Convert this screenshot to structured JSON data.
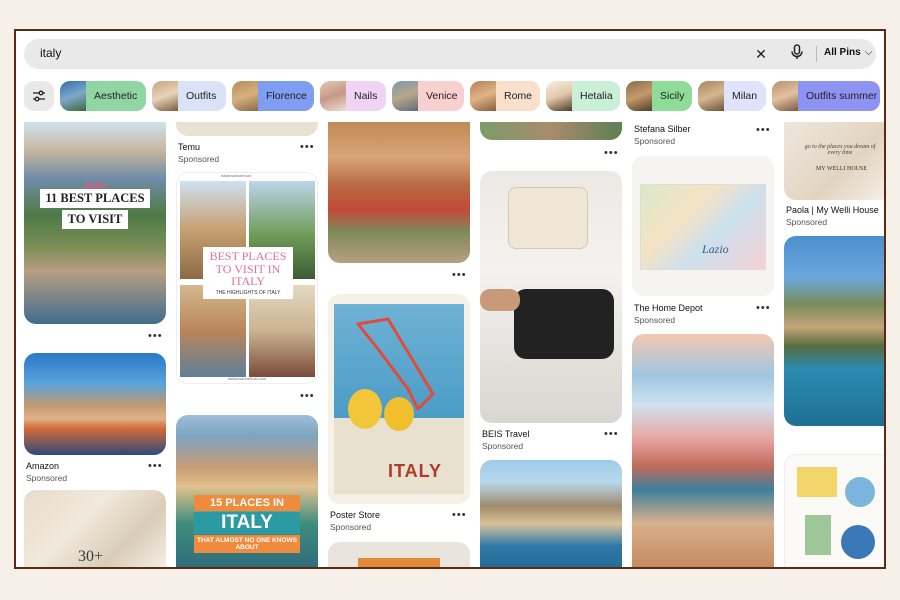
{
  "search": {
    "query": "italy",
    "scope_label": "All Pins"
  },
  "icons": {
    "clear": "close-icon",
    "voice": "microphone-icon",
    "filter": "sliders-icon",
    "chevron": "chevron-down-icon"
  },
  "chips": [
    {
      "label": "Aesthetic",
      "color": "#8fd6a2"
    },
    {
      "label": "Outfits",
      "color": "#d9e3f5"
    },
    {
      "label": "Florence",
      "color": "#7f9df2"
    },
    {
      "label": "Nails",
      "color": "#f0d4f4"
    },
    {
      "label": "Venice",
      "color": "#f8d0d0"
    },
    {
      "label": "Rome",
      "color": "#f8e0cc"
    },
    {
      "label": "Hetalia",
      "color": "#c9efd8"
    },
    {
      "label": "Sicily",
      "color": "#8fdc99"
    },
    {
      "label": "Milan",
      "color": "#dfe3fb"
    },
    {
      "label": "Outfits summer",
      "color": "#8d93f3"
    }
  ],
  "pins": {
    "best_places": {
      "line1": "Italy",
      "line2": "11 BEST PLACES",
      "line3": "TO VISIT"
    },
    "temu": {
      "source": "Temu",
      "sponsored": "Sponsored"
    },
    "wanderlust": {
      "site": "italianwanderlust",
      "title": "BEST PLACES TO VISIT IN ITALY",
      "subtitle": "THE HIGHLIGHTS OF ITALY",
      "footer": "italianwanderlust.com"
    },
    "amazon": {
      "source": "Amazon",
      "sponsored": "Sponsored"
    },
    "fifteen": {
      "line1": "15 PLACES IN",
      "line2": "ITALY",
      "line3": "THAT ALMOST NO ONE KNOWS ABOUT"
    },
    "poster": {
      "title": "ITALY",
      "source": "Poster Store",
      "sponsored": "Sponsored"
    },
    "beis": {
      "source": "BEIS Travel",
      "sponsored": "Sponsored"
    },
    "stefana": {
      "source": "Stefana Silber",
      "sponsored": "Sponsored"
    },
    "homedepot": {
      "map_text": "Lazio",
      "source": "The Home Depot",
      "sponsored": "Sponsored"
    },
    "welli": {
      "quote": "go to the places you dream of every time",
      "brand": "MY WELLI HOUSE",
      "source": "Paola | My Welli House",
      "sponsored": "Sponsored"
    },
    "jewelry": {
      "price": "30+"
    },
    "dots": "•••"
  }
}
